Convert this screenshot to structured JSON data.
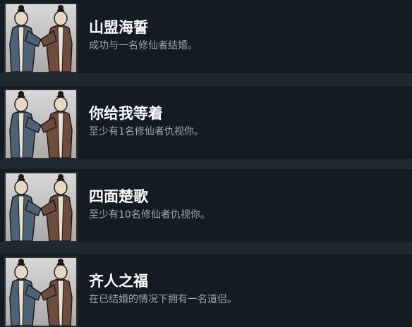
{
  "achievements": [
    {
      "title": "山盟海誓",
      "description": "成功与一名修仙者结婚。",
      "icon": "wedding-couple-icon"
    },
    {
      "title": "你给我等着",
      "description": "至少有1名修仙者仇视你。",
      "icon": "wedding-couple-icon"
    },
    {
      "title": "四面楚歌",
      "description": "至少有10名修仙者仇视你。",
      "icon": "wedding-couple-icon"
    },
    {
      "title": "齐人之福",
      "description": "在已结婚的情况下拥有一名道侣。",
      "icon": "wedding-couple-icon"
    }
  ],
  "colors": {
    "background": "#1f2731",
    "row": "#151b23",
    "title": "#ffffff",
    "description": "#9ba7b2",
    "robe_left": "#4d6177",
    "robe_right": "#6e4b3d"
  }
}
